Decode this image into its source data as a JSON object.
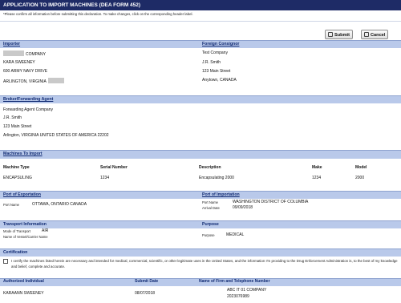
{
  "title": "APPLICATION TO IMPORT MACHINES (DEA FORM 452)",
  "notice": "*Please confirm all information before submitting this declaration. To make changes, click on the corresponding header label.",
  "toolbar": {
    "submit_label": "Submit",
    "cancel_label": "Cancel"
  },
  "importer": {
    "header": "Importer",
    "company": "COMPANY",
    "name": "KARA SWEENEY",
    "street": "600 ARMY NAVY DRIVE",
    "city": "ARLINGTON, VIRGINIA"
  },
  "consignor": {
    "header": "Foreign Consignor",
    "company": "Test Company",
    "name": "J.R. Smith",
    "street": "123 Main Street",
    "city": "Anytown, CANADA"
  },
  "broker": {
    "header": "Broker/Forwarding Agent",
    "company": "Forwarding Agent Company",
    "name": "J.R. Smith",
    "street": "123 Main Street",
    "city": "Arlington, VIRGINIA UNITED STATES OF AMERICA 22202"
  },
  "machines": {
    "header": "Machines To Import",
    "columns": [
      "Machine Type",
      "Serial Number",
      "Description",
      "Make",
      "Model"
    ],
    "rows": [
      [
        "ENCAPSULING",
        "1234",
        "Encapsulating 2000",
        "1234",
        "2000"
      ]
    ]
  },
  "export_port": {
    "header": "Port of Exportation",
    "label": "Port Name",
    "value": "OTTAWA, ONTARIO CANADA"
  },
  "import_port": {
    "header": "Port of Importation",
    "name_label": "Port Name",
    "name_value": "WASHINGTON DISTRICT OF COLUMBIA",
    "date_label": "Arrival Date",
    "date_value": "09/09/2018"
  },
  "transport": {
    "header": "Transport Information",
    "mode_label": "Mode of Transport",
    "mode_value": "AIR",
    "vessel_label": "Name of Vessel/Carrier Name"
  },
  "purpose": {
    "header": "Purpose",
    "label": "Purpose",
    "value": "MEDICAL"
  },
  "certification": {
    "header": "Certification",
    "text": "I certify the machines listed herein are necessary and intended for medical, commercial, scientific, or other legitimate uses in the United States, and the information I'm providing to the Drug Enforcement Administration is, to the best of my knowledge and belief, complete and accurate."
  },
  "signoff": {
    "individual_header": "Authorized Individual",
    "date_header": "Submit Date",
    "firm_header": "Name of Firm and Telephone Number",
    "individual": "KARAANN SWEENEY",
    "date": "08/07/2018",
    "firm": "ABC IT 01 COMPANY",
    "phone": "2023076989"
  }
}
